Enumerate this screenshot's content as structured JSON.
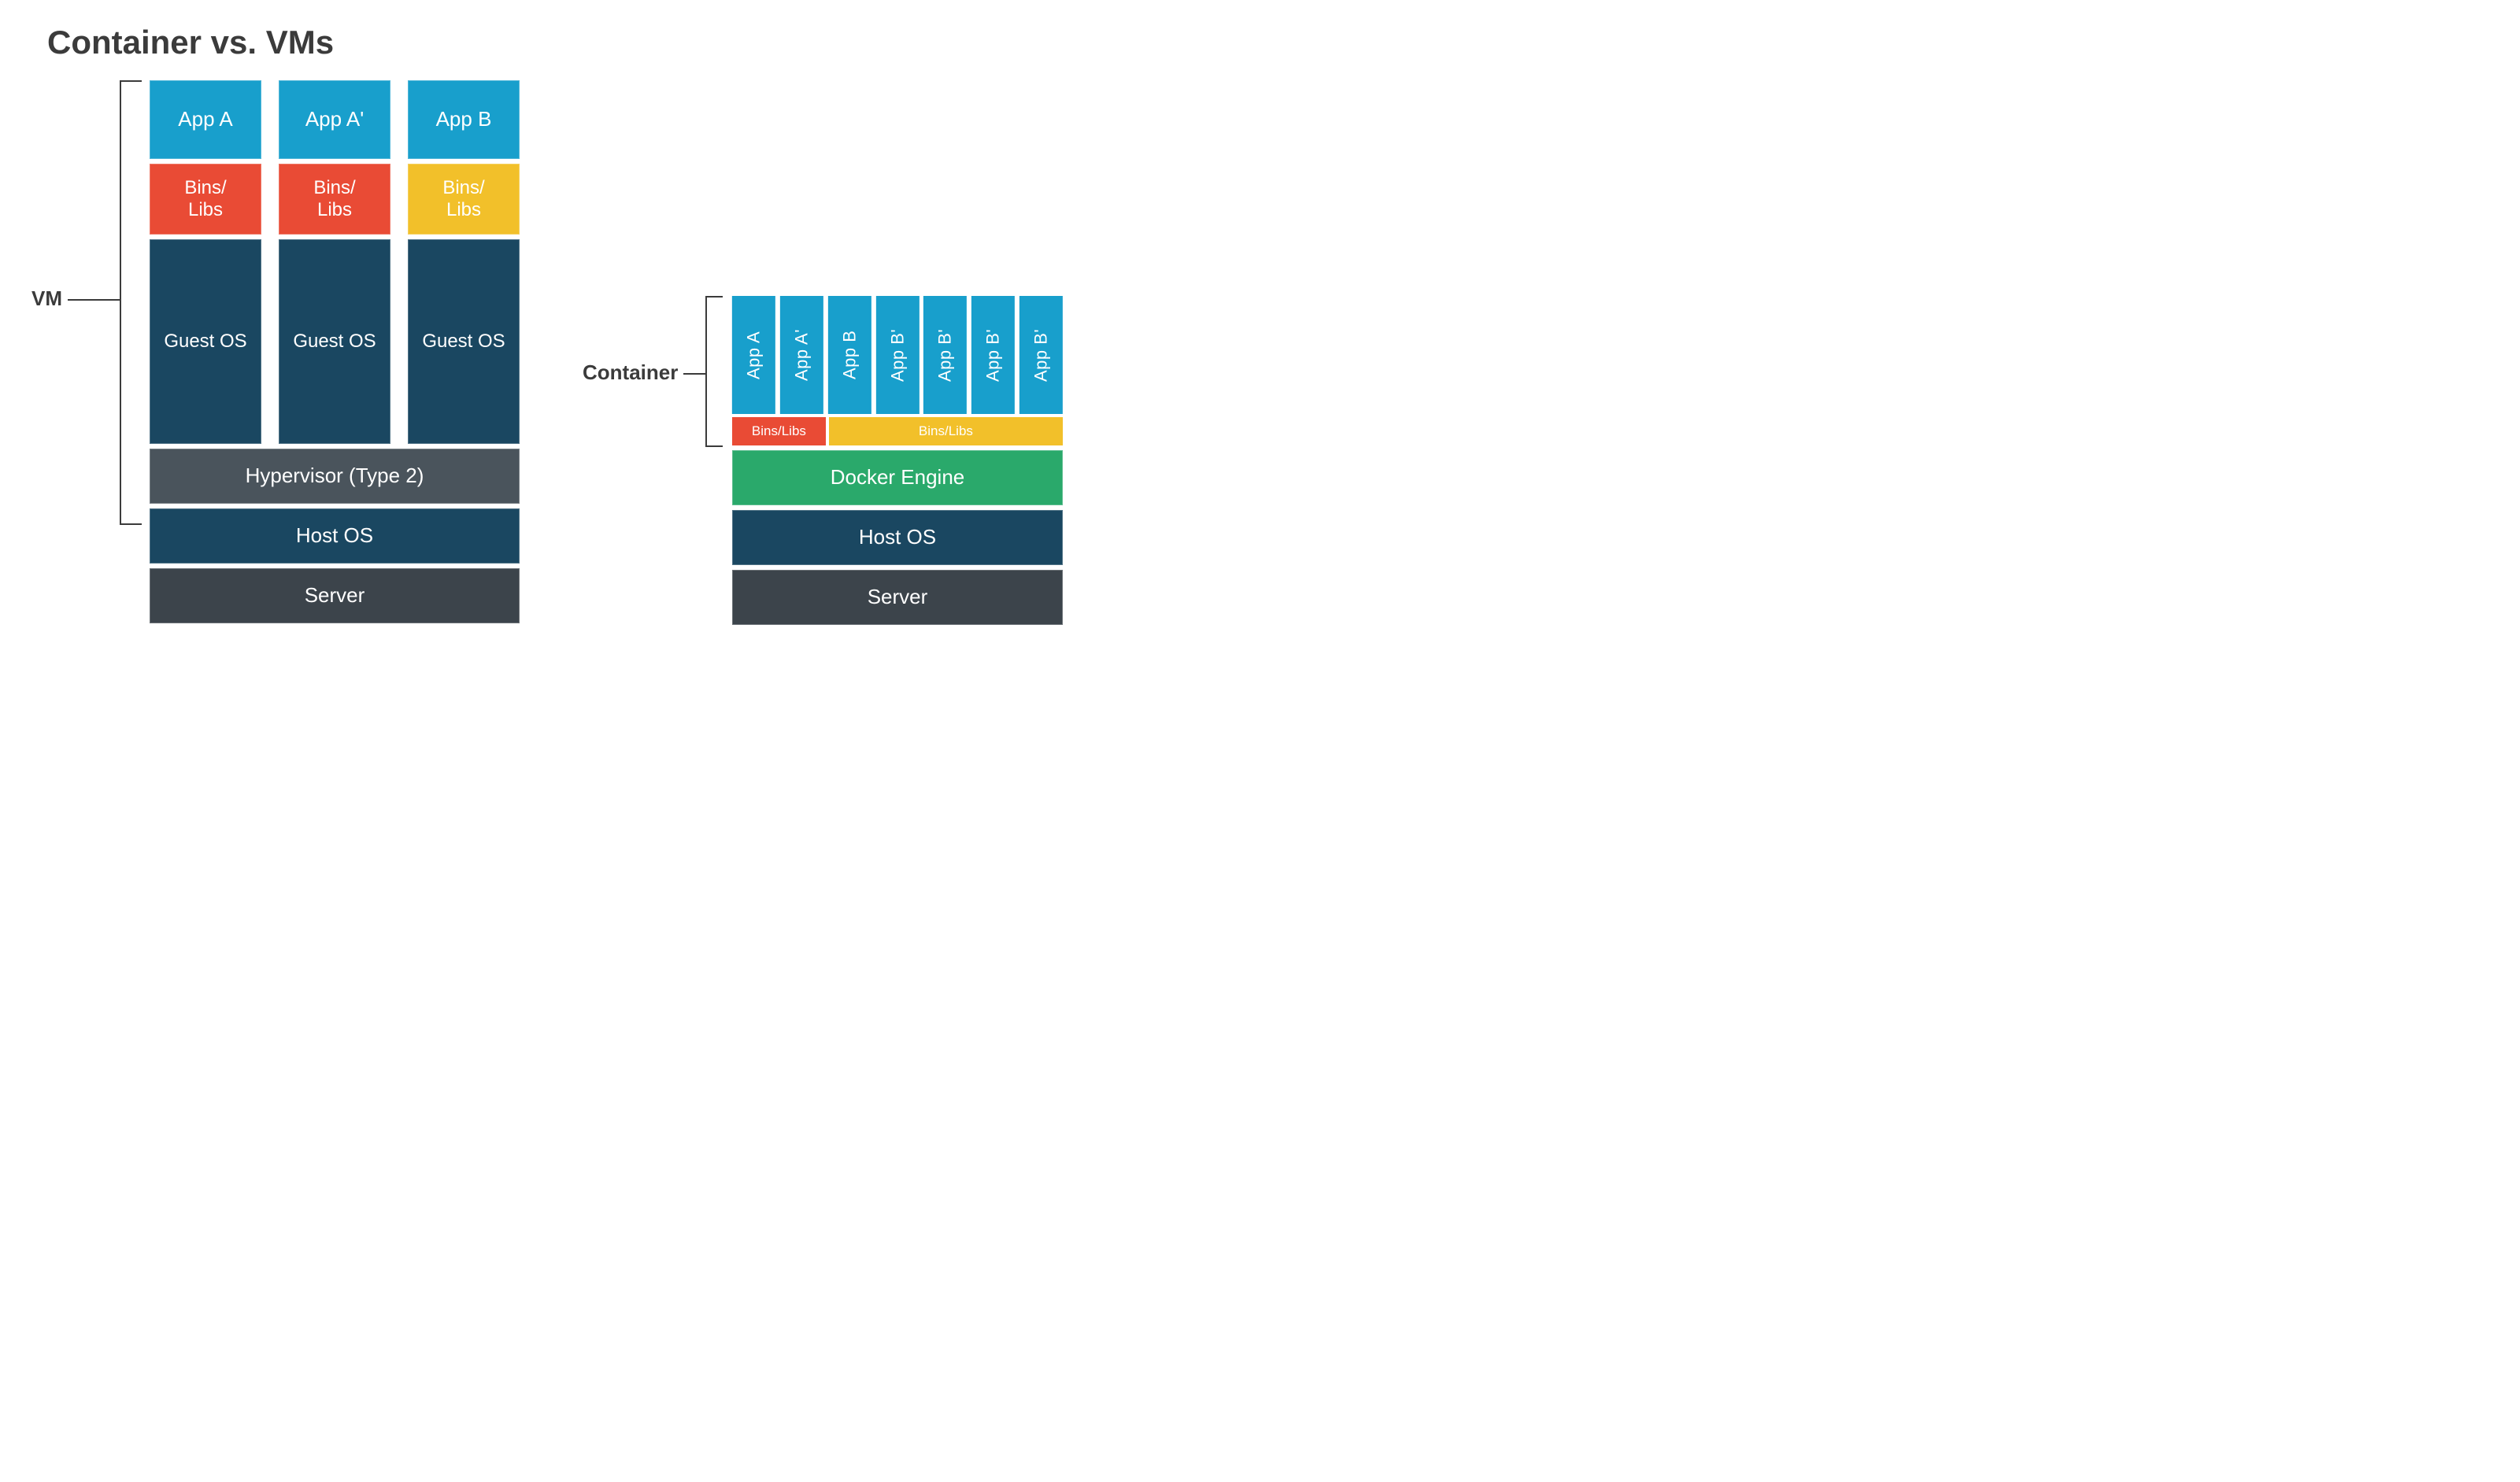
{
  "title": "Container vs. VMs",
  "labels": {
    "vm": "VM",
    "container": "Container"
  },
  "vm": {
    "columns": [
      {
        "app": "App A",
        "bins": "Bins/\nLibs",
        "bins_color": "red",
        "guest": "Guest OS"
      },
      {
        "app": "App A'",
        "bins": "Bins/\nLibs",
        "bins_color": "red",
        "guest": "Guest OS"
      },
      {
        "app": "App B",
        "bins": "Bins/\nLibs",
        "bins_color": "yellow",
        "guest": "Guest OS"
      }
    ],
    "hypervisor": "Hypervisor (Type 2)",
    "host_os": "Host OS",
    "server": "Server"
  },
  "container": {
    "apps": [
      "App A",
      "App A'",
      "App B",
      "App B'",
      "App B'",
      "App B'",
      "App B'"
    ],
    "bins": [
      {
        "label": "Bins/Libs",
        "color": "red"
      },
      {
        "label": "Bins/Libs",
        "color": "yellow"
      }
    ],
    "engine": "Docker Engine",
    "host_os": "Host OS",
    "server": "Server"
  },
  "colors": {
    "app": "#189fcc",
    "bins_red": "#e94b35",
    "bins_yellow": "#f2c02a",
    "guest_host": "#1a4761",
    "hypervisor": "#4a545c",
    "server": "#3c444b",
    "engine": "#2aa96b"
  }
}
